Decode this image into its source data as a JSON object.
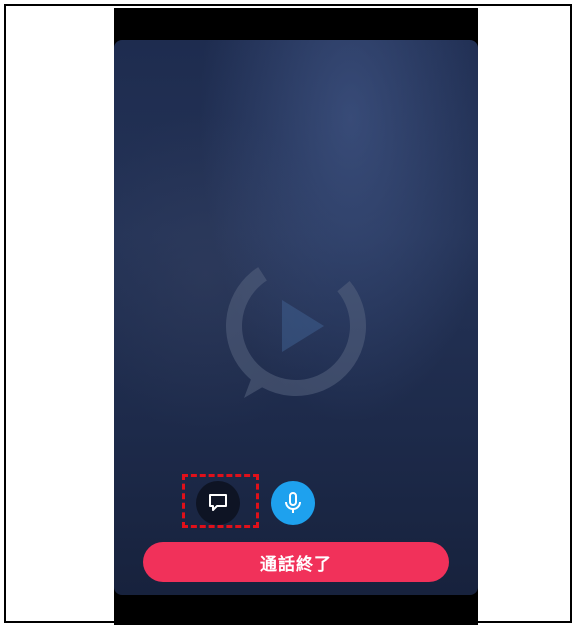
{
  "call_screen": {
    "chat_button": {
      "icon": "chat-bubble-icon"
    },
    "mic_button": {
      "icon": "microphone-icon",
      "color": "#1ea1ee"
    },
    "end_call_button": {
      "label": "通話終了",
      "color": "#f1315a"
    },
    "background_logo": {
      "icon": "play-chat-logo-icon"
    },
    "highlight": {
      "color": "#e0101a"
    }
  }
}
